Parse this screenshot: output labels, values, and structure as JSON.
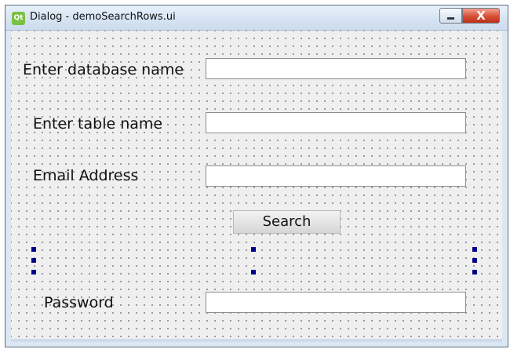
{
  "window": {
    "title": "Dialog - demoSearchRows.ui",
    "app_icon_text": "Qt",
    "minimize_glyph": "—",
    "close_glyph": "X"
  },
  "form": {
    "database_label": "Enter database name",
    "database_value": "",
    "table_label": "Enter table name",
    "table_value": "",
    "email_label": "Email Address",
    "email_value": "",
    "search_button": "Search",
    "password_label": "Password",
    "password_value": ""
  },
  "icons": {
    "app": "qt-logo-icon",
    "minimize": "minimize-icon",
    "close": "close-icon"
  },
  "colors": {
    "handle": "#00008b",
    "close_button": "#d64f34"
  }
}
